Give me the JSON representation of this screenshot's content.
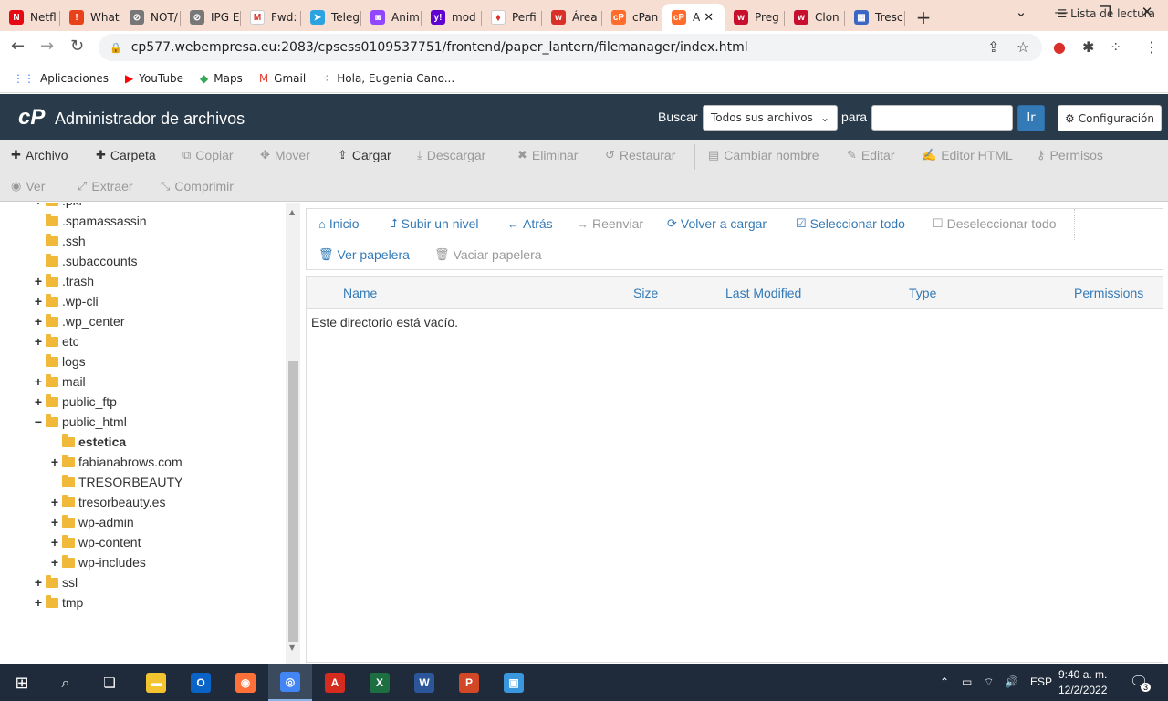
{
  "browser": {
    "tabs": [
      {
        "label": "Netfl",
        "icon": "netflix-icon",
        "color": "#e50914",
        "glyph": "N"
      },
      {
        "label": "What",
        "icon": "whatsapp-alert-icon",
        "color": "#e8421a",
        "glyph": "!"
      },
      {
        "label": "NOT/",
        "icon": "globe-icon",
        "color": "#777777",
        "glyph": "⊘"
      },
      {
        "label": "IPG E",
        "icon": "globe-icon",
        "color": "#777777",
        "glyph": "⊘"
      },
      {
        "label": "Fwd:",
        "icon": "gmail-icon",
        "color": "#ffffff",
        "glyph": "M"
      },
      {
        "label": "Teleg",
        "icon": "telegram-icon",
        "color": "#2aa3e0",
        "glyph": "➤"
      },
      {
        "label": "Anim",
        "icon": "twitch-icon",
        "color": "#9146ff",
        "glyph": "◙"
      },
      {
        "label": "mod",
        "icon": "yahoo-icon",
        "color": "#5f01d1",
        "glyph": "y!"
      },
      {
        "label": "Perfi",
        "icon": "profile-icon",
        "color": "#ffffff",
        "glyph": "⬧"
      },
      {
        "label": "Área",
        "icon": "webempresa-icon",
        "color": "#d9302a",
        "glyph": "w"
      },
      {
        "label": "cPan",
        "icon": "cpanel-icon",
        "color": "#ff6c2c",
        "glyph": "cP"
      },
      {
        "label": "A",
        "icon": "cpanel-icon",
        "color": "#ff6c2c",
        "glyph": "cP",
        "active": true
      },
      {
        "label": "Preg",
        "icon": "webempresa-icon",
        "color": "#c8102e",
        "glyph": "w"
      },
      {
        "label": "Clon",
        "icon": "webempresa-icon",
        "color": "#c8102e",
        "glyph": "w"
      },
      {
        "label": "Tresc",
        "icon": "calendar-icon",
        "color": "#3b66c4",
        "glyph": "▦"
      }
    ],
    "new_tab_glyph": "+",
    "url": "cp577.webempresa.eu:2083/cpsess0109537751/frontend/paper_lantern/filemanager/index.html",
    "bookmarks": [
      {
        "label": "Aplicaciones",
        "icon": "apps-grid-icon",
        "color": "#4285f4",
        "glyph": "⋮⋮"
      },
      {
        "label": "YouTube",
        "icon": "youtube-icon",
        "color": "#ff0000",
        "glyph": "▶"
      },
      {
        "label": "Maps",
        "icon": "maps-icon",
        "color": "#34a853",
        "glyph": "◆"
      },
      {
        "label": "Gmail",
        "icon": "gmail-icon",
        "color": "#ea4335",
        "glyph": "M"
      },
      {
        "label": "Hola, Eugenia Cano...",
        "icon": "loading-icon",
        "color": "#777777",
        "glyph": "⁘"
      }
    ],
    "reading_list": "Lista de lectura"
  },
  "cpanel": {
    "logo": "cP",
    "title": "Administrador de archivos",
    "search_label": "Buscar",
    "search_scope": "Todos sus archivos",
    "para_label": "para",
    "search_value": "",
    "go_label": "Ir",
    "settings_label": "Configuración",
    "brand_color": "#293a4a",
    "link_color": "#337ab7"
  },
  "actions": [
    {
      "label": "Archivo",
      "glyph": "✚",
      "icon": "plus-icon",
      "enabled": true
    },
    {
      "label": "Carpeta",
      "glyph": "✚",
      "icon": "plus-icon",
      "enabled": true
    },
    {
      "label": "Copiar",
      "glyph": "⧉",
      "icon": "copy-icon",
      "enabled": false
    },
    {
      "label": "Mover",
      "glyph": "✥",
      "icon": "move-icon",
      "enabled": false
    },
    {
      "label": "Cargar",
      "glyph": "⇪",
      "icon": "upload-icon",
      "enabled": true
    },
    {
      "label": "Descargar",
      "glyph": "⤓",
      "icon": "download-icon",
      "enabled": false
    },
    {
      "label": "Eliminar",
      "glyph": "✖",
      "icon": "delete-icon",
      "enabled": false
    },
    {
      "label": "Restaurar",
      "glyph": "↺",
      "icon": "restore-icon",
      "enabled": false
    },
    {
      "label": "Cambiar nombre",
      "glyph": "▤",
      "icon": "rename-icon",
      "enabled": false
    },
    {
      "label": "Editar",
      "glyph": "✎",
      "icon": "pencil-icon",
      "enabled": false
    },
    {
      "label": "Editor HTML",
      "glyph": "✍",
      "icon": "html-editor-icon",
      "enabled": false
    },
    {
      "label": "Permisos",
      "glyph": "⚷",
      "icon": "key-icon",
      "enabled": false
    },
    {
      "label": "Ver",
      "glyph": "◉",
      "icon": "eye-icon",
      "enabled": false
    },
    {
      "label": "Extraer",
      "glyph": "⤢",
      "icon": "extract-icon",
      "enabled": false
    },
    {
      "label": "Comprimir",
      "glyph": "⤡",
      "icon": "compress-icon",
      "enabled": false
    }
  ],
  "tree": [
    {
      "label": ".pki",
      "expander": "+"
    },
    {
      "label": ".spamassassin",
      "expander": ""
    },
    {
      "label": ".ssh",
      "expander": ""
    },
    {
      "label": ".subaccounts",
      "expander": ""
    },
    {
      "label": ".trash",
      "expander": "+"
    },
    {
      "label": ".wp-cli",
      "expander": "+"
    },
    {
      "label": ".wp_center",
      "expander": "+"
    },
    {
      "label": "etc",
      "expander": "+"
    },
    {
      "label": "logs",
      "expander": ""
    },
    {
      "label": "mail",
      "expander": "+"
    },
    {
      "label": "public_ftp",
      "expander": "+"
    },
    {
      "label": "public_html",
      "expander": "−",
      "open": true
    },
    {
      "label": "estetica",
      "expander": "",
      "child": true,
      "bold": true
    },
    {
      "label": "fabianabrows.com",
      "expander": "+",
      "child": true
    },
    {
      "label": "TRESORBEAUTY",
      "expander": "",
      "child": true
    },
    {
      "label": "tresorbeauty.es",
      "expander": "+",
      "child": true
    },
    {
      "label": "wp-admin",
      "expander": "+",
      "child": true
    },
    {
      "label": "wp-content",
      "expander": "+",
      "child": true
    },
    {
      "label": "wp-includes",
      "expander": "+",
      "child": true
    },
    {
      "label": "ssl",
      "expander": "+"
    },
    {
      "label": "tmp",
      "expander": "+"
    }
  ],
  "nav": [
    {
      "label": "Inicio",
      "glyph": "⌂",
      "icon": "home-icon",
      "enabled": true
    },
    {
      "label": "Subir un nivel",
      "glyph": "⮥",
      "icon": "level-up-icon",
      "enabled": true
    },
    {
      "label": "Atrás",
      "glyph": "←",
      "icon": "back-arrow-icon",
      "enabled": true
    },
    {
      "label": "Reenviar",
      "glyph": "→",
      "icon": "forward-arrow-icon",
      "enabled": false
    },
    {
      "label": "Volver a cargar",
      "glyph": "⟳",
      "icon": "reload-icon",
      "enabled": true
    },
    {
      "label": "Seleccionar todo",
      "glyph": "☑",
      "icon": "checkbox-checked-icon",
      "enabled": true
    },
    {
      "label": "Deseleccionar todo",
      "glyph": "☐",
      "icon": "checkbox-empty-icon",
      "enabled": false
    },
    {
      "label": "Ver papelera",
      "glyph": "🗑",
      "icon": "trash-icon",
      "enabled": true
    },
    {
      "label": "Vaciar papelera",
      "glyph": "🗑",
      "icon": "trash-icon",
      "enabled": false
    }
  ],
  "table": {
    "columns": [
      "Name",
      "Size",
      "Last Modified",
      "Type",
      "Permissions"
    ],
    "empty_message": "Este directorio está vacío."
  },
  "taskbar": {
    "language": "ESP",
    "time": "9:40 a. m.",
    "date": "12/2/2022",
    "notifications": "3",
    "apps": [
      {
        "name": "file-explorer-icon",
        "color": "#f4c430",
        "glyph": "▬"
      },
      {
        "name": "outlook-icon",
        "color": "#0a64c8",
        "glyph": "O"
      },
      {
        "name": "firefox-icon",
        "color": "#ff7139",
        "glyph": "◉"
      },
      {
        "name": "chrome-icon",
        "color": "#4285f4",
        "glyph": "◎",
        "active": true
      },
      {
        "name": "acrobat-icon",
        "color": "#d62b1f",
        "glyph": "A"
      },
      {
        "name": "excel-icon",
        "color": "#1d6f42",
        "glyph": "X"
      },
      {
        "name": "word-icon",
        "color": "#2b579a",
        "glyph": "W"
      },
      {
        "name": "powerpoint-icon",
        "color": "#d24726",
        "glyph": "P"
      },
      {
        "name": "remote-desktop-icon",
        "color": "#3a96dd",
        "glyph": "▣"
      }
    ]
  }
}
